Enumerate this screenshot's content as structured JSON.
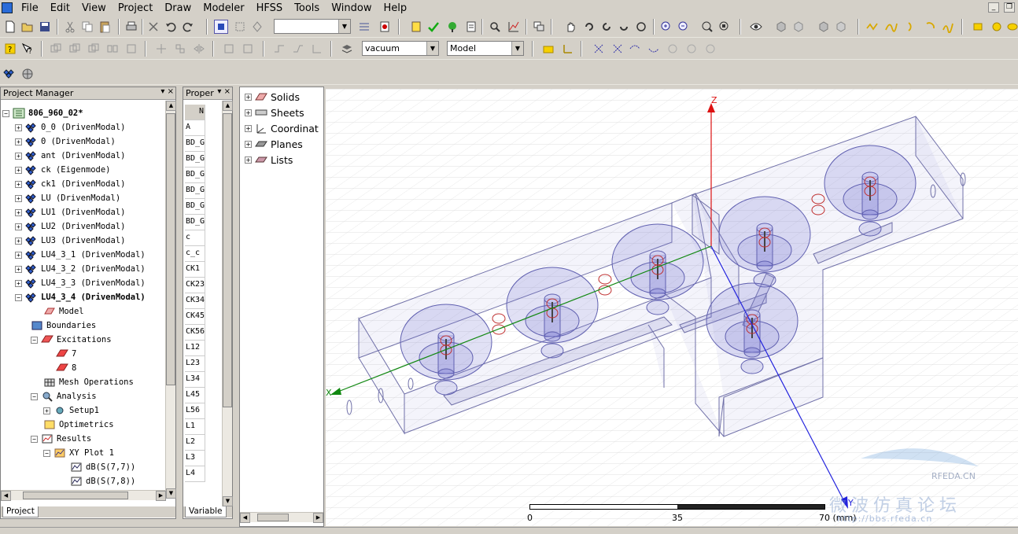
{
  "menu": [
    "File",
    "Edit",
    "View",
    "Project",
    "Draw",
    "Modeler",
    "HFSS",
    "Tools",
    "Window",
    "Help"
  ],
  "toolbar": {
    "combo_blank": "",
    "material": "vacuum",
    "view_mode": "Model"
  },
  "project_manager": {
    "title": "Project Manager",
    "root": "806_960_02*",
    "designs": [
      "0_0 (DrivenModal)",
      "0 (DrivenModal)",
      "ant (DrivenModal)",
      "ck (Eigenmode)",
      "ck1 (DrivenModal)",
      "LU (DrivenModal)",
      "LU1 (DrivenModal)",
      "LU2 (DrivenModal)",
      "LU3 (DrivenModal)",
      "LU4_3_1 (DrivenModal)",
      "LU4_3_2 (DrivenModal)",
      "LU4_3_3 (DrivenModal)"
    ],
    "active_design": "LU4_3_4 (DrivenModal)",
    "nodes": {
      "model": "Model",
      "boundaries": "Boundaries",
      "excitations": "Excitations",
      "exc1": "7",
      "exc2": "8",
      "mesh": "Mesh Operations",
      "analysis": "Analysis",
      "setup": "Setup1",
      "optimetrics": "Optimetrics",
      "results": "Results",
      "plot": "XY Plot 1",
      "trace1": "dB(S(7,7))",
      "trace2": "dB(S(7,8))"
    },
    "tab": "Project"
  },
  "properties": {
    "title": "Proper",
    "header": "N",
    "rows": [
      "A",
      "BD_G",
      "BD_G",
      "BD_G",
      "BD_G",
      "BD_G",
      "BD_G",
      "c",
      "c_c",
      "CK1",
      "CK23",
      "CK34",
      "CK45",
      "CK56",
      "L12",
      "L23",
      "L34",
      "L45",
      "L56",
      "L1",
      "L2",
      "L3",
      "L4"
    ],
    "tab": "Variable"
  },
  "history": {
    "items": [
      "Solids",
      "Sheets",
      "Coordinat",
      "Planes",
      "Lists"
    ]
  },
  "viewport": {
    "axis_x": "X",
    "axis_y": "Y",
    "axis_z": "Z",
    "ruler": {
      "left": "0",
      "mid": "35",
      "right": "70 (mm)"
    },
    "watermark_cn": "微波仿真论坛",
    "watermark_url": "http://bbs.rfeda.cn",
    "watermark_logo": "RFEDA.CN"
  },
  "colors": {
    "ui_bg": "#d4d0c8",
    "x_axis": "#118811",
    "y_axis": "#2222dd",
    "z_axis": "#dd1111",
    "model_edge": "#7070a8"
  }
}
